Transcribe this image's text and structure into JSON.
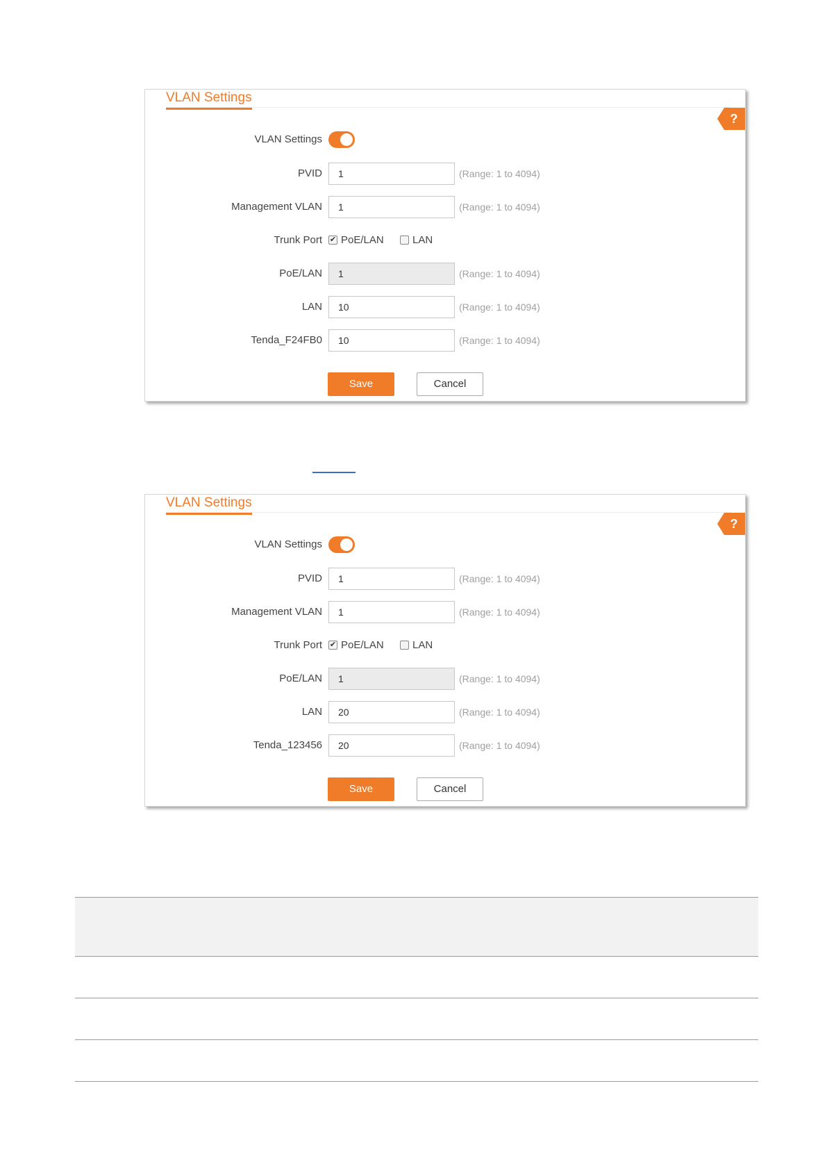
{
  "panels": [
    {
      "title": "VLAN Settings",
      "help": "?",
      "vlan_settings_label": "VLAN Settings",
      "pvid": {
        "label": "PVID",
        "value": "1",
        "range": "(Range: 1 to 4094)"
      },
      "mgmt_vlan": {
        "label": "Management VLAN",
        "value": "1",
        "range": "(Range: 1 to 4094)"
      },
      "trunk_port": {
        "label": "Trunk Port",
        "opt1": "PoE/LAN",
        "opt1_checked": true,
        "opt2": "LAN",
        "opt2_checked": false
      },
      "poe_lan": {
        "label": "PoE/LAN",
        "value": "1",
        "range": "(Range: 1 to 4094)"
      },
      "lan": {
        "label": "LAN",
        "value": "10",
        "range": "(Range: 1 to 4094)"
      },
      "ssid": {
        "label": "Tenda_F24FB0",
        "value": "10",
        "range": "(Range: 1 to 4094)"
      },
      "save": "Save",
      "cancel": "Cancel"
    },
    {
      "title": "VLAN Settings",
      "help": "?",
      "vlan_settings_label": "VLAN Settings",
      "pvid": {
        "label": "PVID",
        "value": "1",
        "range": "(Range: 1 to 4094)"
      },
      "mgmt_vlan": {
        "label": "Management VLAN",
        "value": "1",
        "range": "(Range: 1 to 4094)"
      },
      "trunk_port": {
        "label": "Trunk Port",
        "opt1": "PoE/LAN",
        "opt1_checked": true,
        "opt2": "LAN",
        "opt2_checked": false
      },
      "poe_lan": {
        "label": "PoE/LAN",
        "value": "1",
        "range": "(Range: 1 to 4094)"
      },
      "lan": {
        "label": "LAN",
        "value": "20",
        "range": "(Range: 1 to 4094)"
      },
      "ssid": {
        "label": "Tenda_123456",
        "value": "20",
        "range": "(Range: 1 to 4094)"
      },
      "save": "Save",
      "cancel": "Cancel"
    }
  ],
  "colors": {
    "accent": "#f07c2a",
    "link": "#3a6fc4"
  }
}
